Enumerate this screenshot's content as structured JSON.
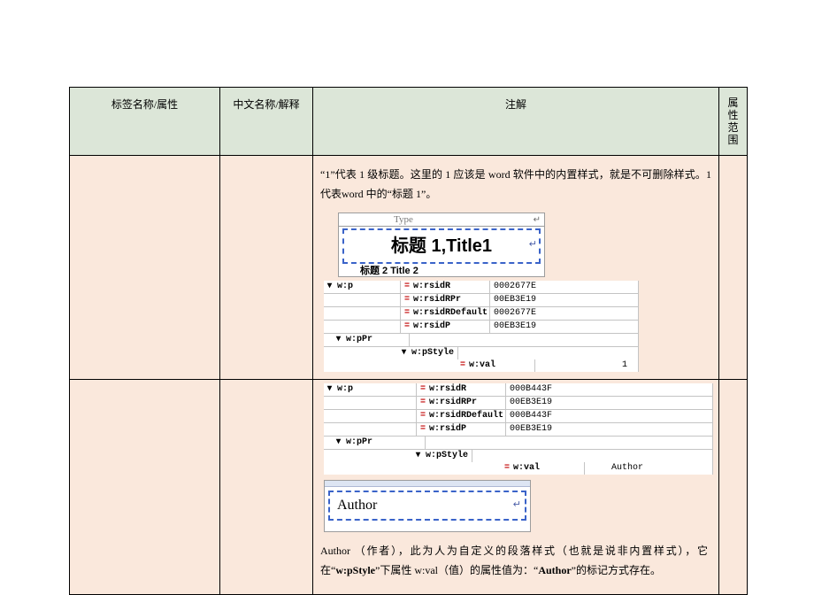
{
  "headers": {
    "col1": "标签名称/属性",
    "col2": "中文名称/解释",
    "col3": "注解",
    "col4a": "属性",
    "col4b": "范围"
  },
  "row1": {
    "note1": "“1”代表 1 级标题。这里的 1 应该是 word 软件中的内置样式，就是不可删除样式。1 代表word 中的“标题 1”。",
    "wordbox": {
      "top_label": "Type",
      "main": "标题 1,Title1",
      "bottom_hint": "标题 2  Title 2"
    },
    "xml": {
      "root": "w:p",
      "attrs": [
        {
          "k": "w:rsidR",
          "v": "0002677E"
        },
        {
          "k": "w:rsidRPr",
          "v": "00EB3E19"
        },
        {
          "k": "w:rsidRDefault",
          "v": "0002677E"
        },
        {
          "k": "w:rsidP",
          "v": "00EB3E19"
        }
      ],
      "child": "w:pPr",
      "grandchild": "w:pStyle",
      "leaf_attr": {
        "k": "w:val",
        "v": "1"
      }
    }
  },
  "row2": {
    "xml": {
      "root": "w:p",
      "attrs": [
        {
          "k": "w:rsidR",
          "v": "000B443F"
        },
        {
          "k": "w:rsidRPr",
          "v": "00EB3E19"
        },
        {
          "k": "w:rsidRDefault",
          "v": "000B443F"
        },
        {
          "k": "w:rsidP",
          "v": "00EB3E19"
        }
      ],
      "child": "w:pPr",
      "grandchild": "w:pStyle",
      "leaf_attr": {
        "k": "w:val",
        "v": "Author"
      }
    },
    "wordbox": {
      "main": "Author"
    },
    "note_parts": {
      "p1": "    Author （作者），此为人为自定义的段落样式（也就是说非内置样式），它在“",
      "bold1": "w:pStyle",
      "p2": "”下属性 w:val（值）的属性值为：“",
      "bold2": "Author",
      "p3": "”的标记方式存在。"
    }
  }
}
